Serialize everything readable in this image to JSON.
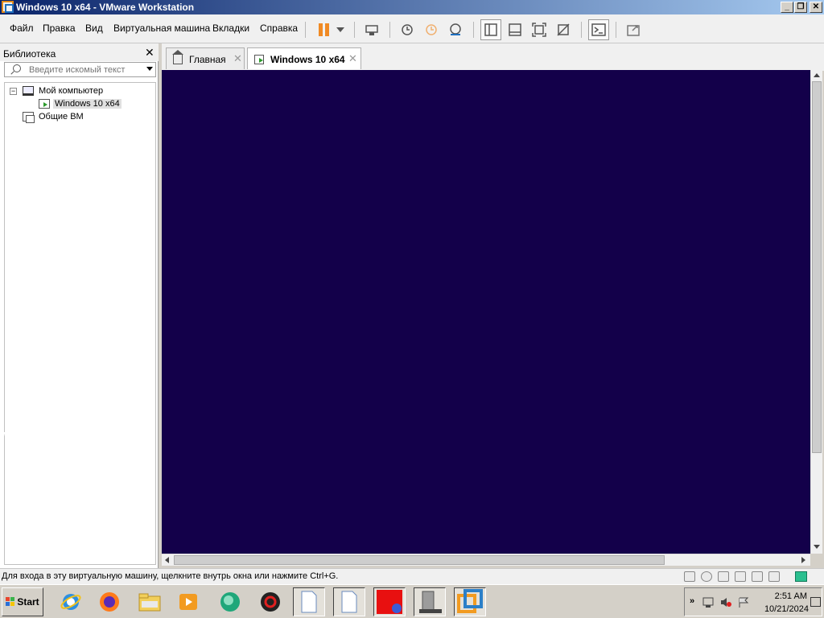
{
  "window": {
    "title": "Windows 10 x64 - VMware Workstation",
    "minimize_label": "_",
    "maximize_label": "❐",
    "close_label": "✕"
  },
  "menu": {
    "file": "Файл",
    "edit": "Правка",
    "view": "Вид",
    "vm": "Виртуальная машина",
    "tabs": "Вкладки",
    "help": "Справка"
  },
  "toolbar": {
    "icons": [
      "pause-icon",
      "power-dropdown-icon",
      "send-ctrl-alt-del-icon",
      "snapshot-icon",
      "revert-snapshot-icon",
      "snapshot-manager-icon",
      "show-library-icon",
      "thumbnail-bar-icon",
      "full-screen-icon",
      "unity-icon",
      "console-view-icon",
      "stretch-icon"
    ],
    "accent_color": "#f08a24"
  },
  "library": {
    "title": "Библиотека",
    "close_label": "✕",
    "search_placeholder": "Введите искомый текст",
    "tree": {
      "my_computer": "Мой компьютер",
      "collapse_toggle": "−",
      "vm_name": "Windows 10 x64",
      "shared_vms": "Общие ВМ"
    }
  },
  "tabs": [
    {
      "label": "Главная",
      "icon": "home-icon",
      "close": "✕"
    },
    {
      "label": "Windows 10 x64",
      "icon": "vm-icon",
      "close": "✕",
      "active": true
    }
  ],
  "vm_display": {
    "background_color": "#13004a"
  },
  "status": {
    "message": "Для входа в эту виртуальную машину, щелкните внутрь окна или нажмите Ctrl+G."
  },
  "taskbar": {
    "start_label": "Start",
    "apps": [
      "internet-explorer-icon",
      "firefox-icon",
      "file-explorer-icon",
      "media-player-icon",
      "messenger-icon",
      "security-app-icon",
      "document-icon",
      "document-icon",
      "red-app-icon",
      "server-app-icon",
      "vmware-icon"
    ],
    "tray_chevron": "»",
    "time": "2:51 AM",
    "date": "10/21/2024"
  }
}
